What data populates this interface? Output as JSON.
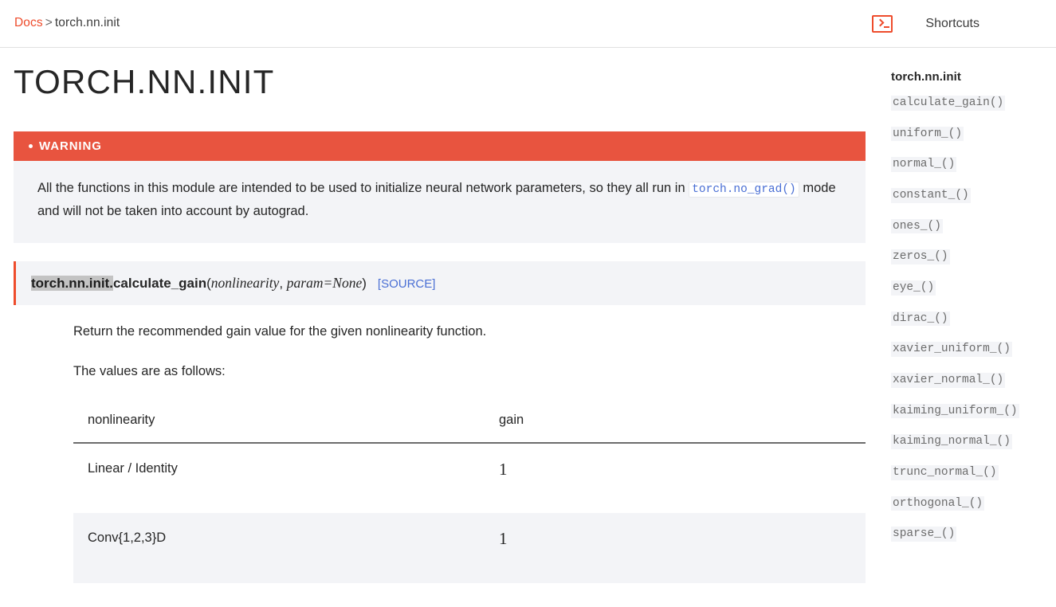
{
  "theme": {
    "accent": "#ee4c2c",
    "warning_bg": "#e8543f",
    "panel_bg": "#f3f4f7",
    "link_blue": "#4a6fd4",
    "text": "#262626"
  },
  "header": {
    "breadcrumb": {
      "root_label": "Docs",
      "separator": ">",
      "current_label": "torch.nn.init"
    },
    "shortcuts_label": "Shortcuts",
    "terminal_icon_name": "terminal-icon"
  },
  "page": {
    "title": "TORCH.NN.INIT"
  },
  "warning": {
    "title": "WARNING",
    "text_before_code": "All the functions in this module are intended to be used to initialize neural network parameters, so they all run in",
    "code": "torch.no_grad()",
    "text_after_code": "mode and will not be taken into account by autograd."
  },
  "signature": {
    "prefix": "torch.nn.init.",
    "name": "calculate_gain",
    "open_paren": "(",
    "param1": "nonlinearity",
    "comma": ", ",
    "param2": "param=None",
    "close_paren": ")",
    "source_link": "[SOURCE]"
  },
  "description": {
    "line1": "Return the recommended gain value for the given nonlinearity function.",
    "line2": "The values are as follows:"
  },
  "gain_table": {
    "columns": [
      "nonlinearity",
      "gain"
    ],
    "rows": [
      {
        "nonlinearity": "Linear / Identity",
        "gain": "1"
      },
      {
        "nonlinearity": "Conv{1,2,3}D",
        "gain": "1"
      }
    ]
  },
  "rightbar": {
    "title": "torch.nn.init",
    "items": [
      {
        "label": "calculate_gain()"
      },
      {
        "label": "uniform_()"
      },
      {
        "label": "normal_()"
      },
      {
        "label": "constant_()"
      },
      {
        "label": "ones_()"
      },
      {
        "label": "zeros_()"
      },
      {
        "label": "eye_()"
      },
      {
        "label": "dirac_()"
      },
      {
        "label": "xavier_uniform_()"
      },
      {
        "label": "xavier_normal_()"
      },
      {
        "label": "kaiming_uniform_()"
      },
      {
        "label": "kaiming_normal_()"
      },
      {
        "label": "trunc_normal_()"
      },
      {
        "label": "orthogonal_()"
      },
      {
        "label": "sparse_()"
      }
    ]
  }
}
